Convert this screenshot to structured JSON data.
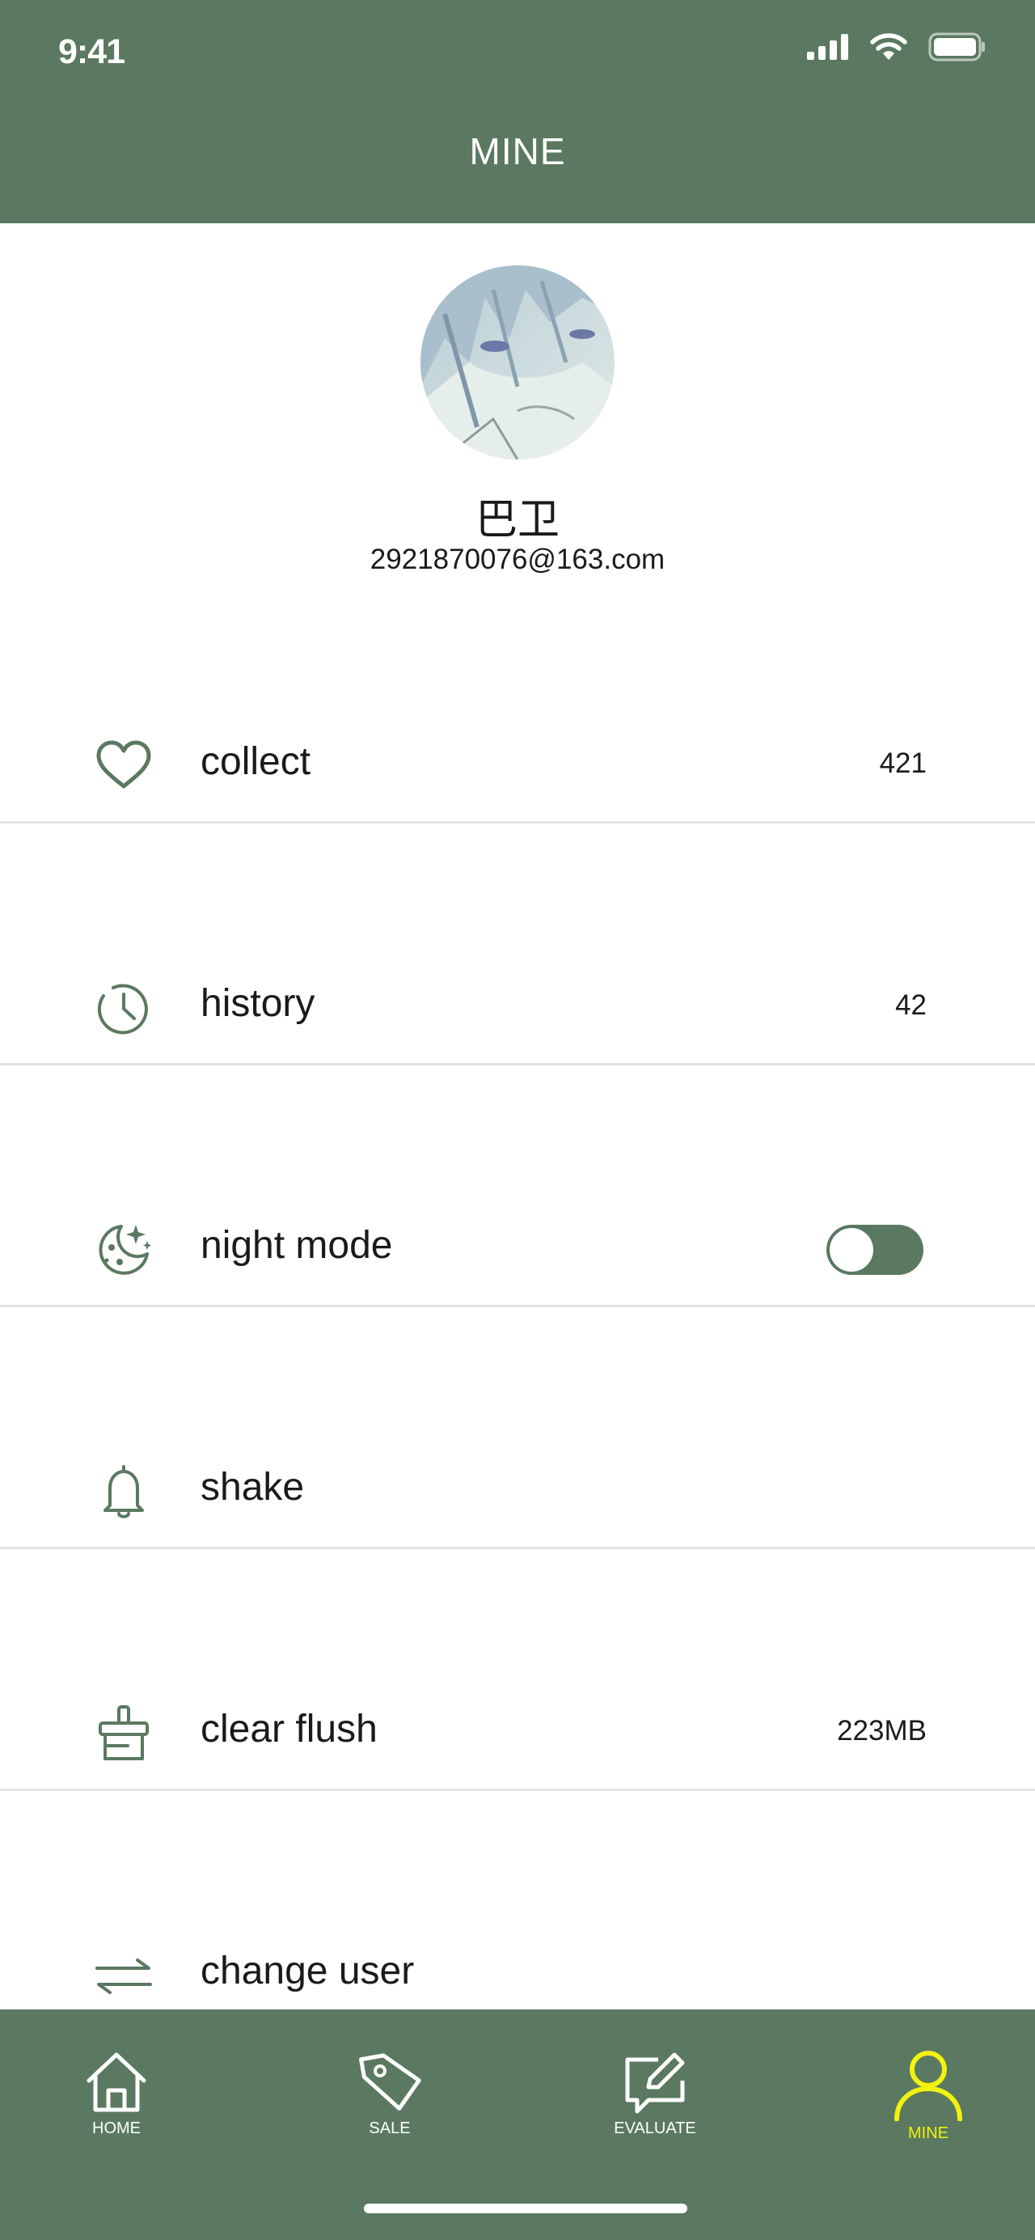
{
  "status_bar": {
    "time": "9:41"
  },
  "header": {
    "title": "MINE"
  },
  "profile": {
    "name": "巴卫",
    "email": "2921870076@163.com"
  },
  "menu": [
    {
      "label": "collect",
      "value": "421",
      "icon": "heart-icon"
    },
    {
      "label": "history",
      "value": "42",
      "icon": "clock-icon"
    },
    {
      "label": "night mode",
      "value": "",
      "icon": "moon-stars-icon",
      "toggle_on": true
    },
    {
      "label": "shake",
      "value": "",
      "icon": "bell-icon"
    },
    {
      "label": "clear flush",
      "value": "223MB",
      "icon": "broom-icon"
    },
    {
      "label": "change user",
      "value": "",
      "icon": "swap-arrows-icon"
    }
  ],
  "tabbar": {
    "tabs": [
      {
        "label": "HOME",
        "icon": "home-icon"
      },
      {
        "label": "SALE",
        "icon": "tag-icon"
      },
      {
        "label": "EVALUATE",
        "icon": "edit-message-icon"
      },
      {
        "label": "MINE",
        "icon": "person-icon",
        "active": true
      }
    ]
  },
  "colors": {
    "primary": "#5a7960",
    "active_tab": "#f1f20f",
    "icon": "#5a7960",
    "divider": "#e3e3e3"
  }
}
